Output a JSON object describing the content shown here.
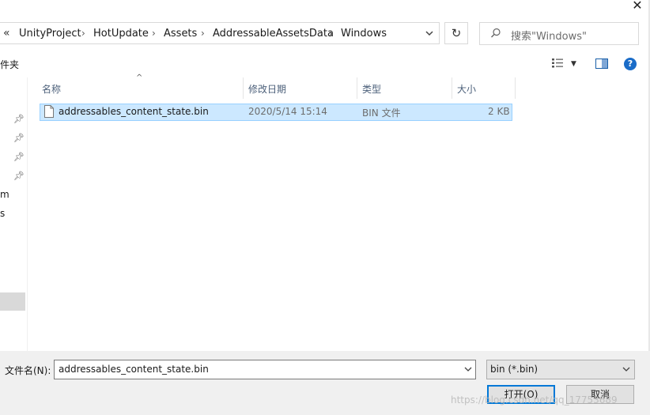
{
  "window": {
    "close_glyph": "✕"
  },
  "address_bar": {
    "back_glyph": "«",
    "crumbs": [
      "UnityProject",
      "HotUpdate",
      "Assets",
      "AddressableAssetsData",
      "Windows"
    ],
    "separator": "›",
    "refresh_glyph": "↻"
  },
  "search": {
    "placeholder": "搜索\"Windows\""
  },
  "toolbar": {
    "new_folder_label": "件夹",
    "view_dropdown_glyph": "▼",
    "help_label": "?"
  },
  "nav_pane": {
    "text_fragments": [
      "m",
      "s"
    ]
  },
  "columns": {
    "name": "名称",
    "date_modified": "修改日期",
    "type": "类型",
    "size": "大小",
    "sort_glyph": "^"
  },
  "files": [
    {
      "name": "addressables_content_state.bin",
      "date_modified": "2020/5/14 15:14",
      "type": "BIN 文件",
      "size": "2 KB",
      "selected": true
    }
  ],
  "footer": {
    "filename_label": "文件名(N):",
    "filename_value": "addressables_content_state.bin",
    "filetype_value": "bin (*.bin)",
    "open_button": "打开(O)",
    "cancel_button": "取消",
    "watermark": "https://blog.csdn.net/qq_17753689"
  },
  "colors": {
    "selection_bg": "#cce8ff",
    "selection_border": "#99d1ff",
    "accent": "#0078d7",
    "header_text": "#4c607a"
  }
}
